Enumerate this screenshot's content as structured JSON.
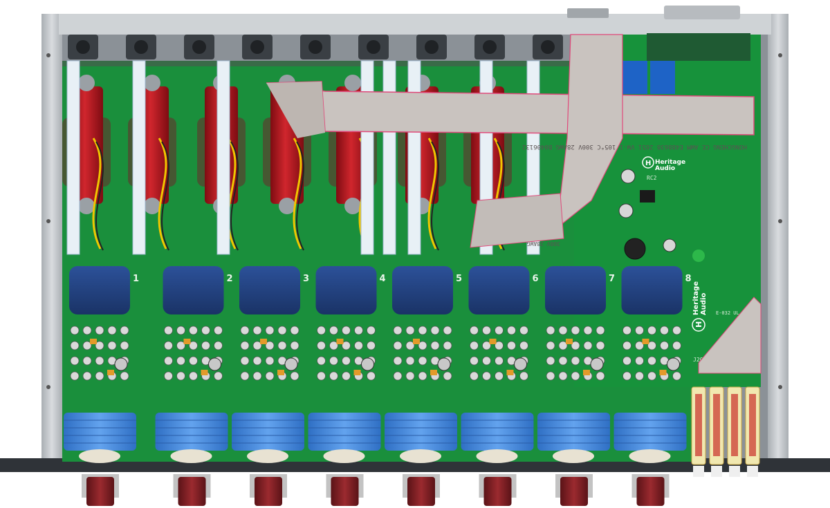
{
  "brand": {
    "name_line1": "Heritage",
    "name_line2": "Audio",
    "logo_letter": "H"
  },
  "channels": {
    "count": 8,
    "labels": [
      "1",
      "2",
      "3",
      "4",
      "5",
      "6",
      "7",
      "8"
    ]
  },
  "ribbon_text": "HONGCHENG  CE  AWM  E488638  2651  VW-1  105°C  300V  28AWG  B0406132",
  "ribbon_text_2": "300V  28AWG",
  "board_refs": {
    "connector": "J20",
    "relay_area": "RC2",
    "spec": "E-032 UL 94V-0"
  },
  "colors": {
    "pcb_green": "#138a3a",
    "pcb_dark": "#0d6b2c",
    "transformer_blue": "#1f3f7a",
    "pot_blue": "#3d7fd6",
    "knob_red": "#7a1e22",
    "red_transformer": "#b5121b",
    "chassis_gray": "#c9cdd1",
    "ribbon_gray": "#c7c1bd"
  }
}
